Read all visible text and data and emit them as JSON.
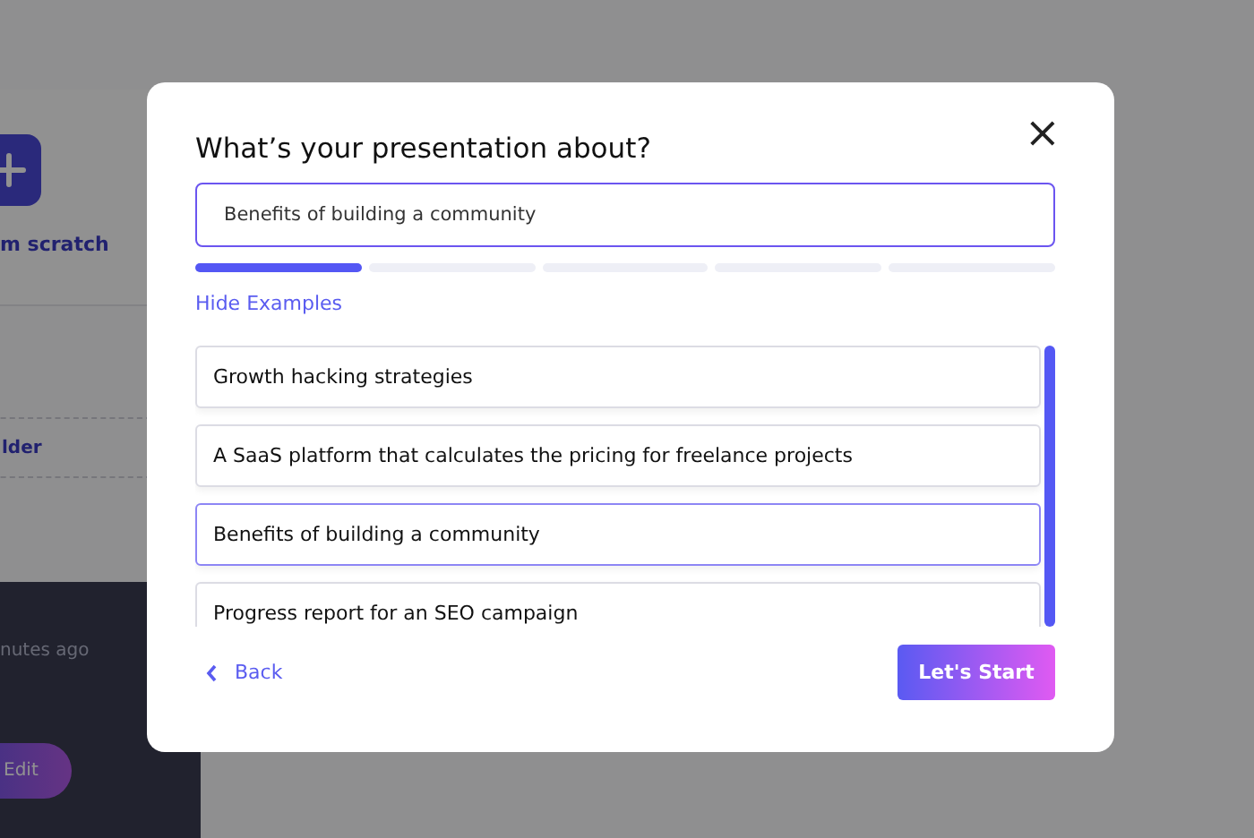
{
  "background": {
    "new_card": {
      "label": "m scratch"
    },
    "folder": {
      "label": "lder"
    },
    "recent": {
      "time": "nutes ago",
      "edit_button": "Edit"
    }
  },
  "dialog": {
    "title": "What’s your presentation about?",
    "close": "×",
    "input": {
      "value": "Benefits of building a community"
    },
    "steps": [
      {
        "done": true
      },
      {
        "done": false
      },
      {
        "done": false
      },
      {
        "done": false
      },
      {
        "done": false
      }
    ],
    "toggle_examples": "Hide Examples",
    "examples": [
      {
        "label": "Growth hacking strategies",
        "selected": false
      },
      {
        "label": "A SaaS platform that calculates the pricing for freelance projects",
        "selected": false
      },
      {
        "label": "Benefits of building a community",
        "selected": true
      },
      {
        "label": "Progress report for an SEO campaign",
        "selected": false
      }
    ],
    "back": "Back",
    "start": "Let's Start"
  }
}
